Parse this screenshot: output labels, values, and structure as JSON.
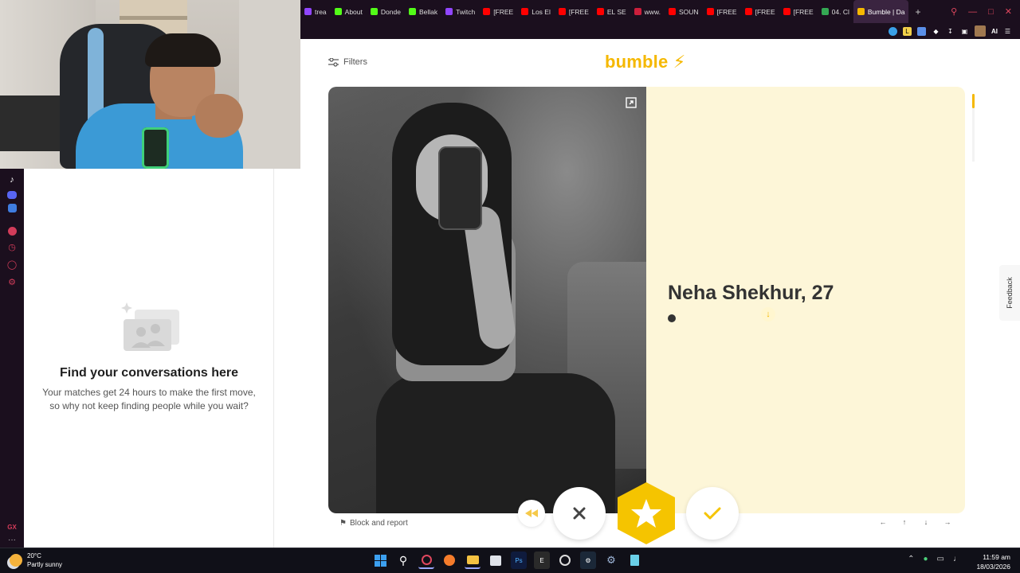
{
  "browser": {
    "tabs": [
      {
        "label": "trea",
        "color": "#9146ff"
      },
      {
        "label": "About",
        "color": "#53fc18"
      },
      {
        "label": "Donde",
        "color": "#53fc18"
      },
      {
        "label": "Bellak",
        "color": "#53fc18"
      },
      {
        "label": "Twitch",
        "color": "#9146ff"
      },
      {
        "label": "[FREE",
        "color": "#ff0000"
      },
      {
        "label": "Los El",
        "color": "#ff0000"
      },
      {
        "label": "[FREE",
        "color": "#ff0000"
      },
      {
        "label": "EL SE",
        "color": "#ff0000"
      },
      {
        "label": "www.",
        "color": "#cc1f3c"
      },
      {
        "label": "SOUN",
        "color": "#ff0000"
      },
      {
        "label": "[FREE",
        "color": "#ff0000"
      },
      {
        "label": "[FREE",
        "color": "#ff0000"
      },
      {
        "label": "[FREE",
        "color": "#ff0000"
      },
      {
        "label": "04. Cl",
        "color": "#34a853"
      },
      {
        "label": "Bumble | Da",
        "color": "#f5b800",
        "active": true
      }
    ],
    "new_tab": "+",
    "ai_label": "AI"
  },
  "sidebar_icons": [
    "tiktok-icon",
    "discord-icon",
    "messenger-icon",
    "spotify-icon",
    "history-icon",
    "chat-icon",
    "settings-icon"
  ],
  "sidebar_bottom": {
    "gx": "GX",
    "more": "···"
  },
  "conversations": {
    "title": "Find your conversations here",
    "subtitle": "Your matches get 24 hours to make the first move, so why not keep finding people while you wait?"
  },
  "header": {
    "filters_label": "Filters",
    "logo_text": "bumble"
  },
  "profile": {
    "name_age": "Neha Shekhur, 27"
  },
  "actions": {
    "block_report": "Block and report"
  },
  "keyboard_hints": [
    "←",
    "↑",
    "↓",
    "→"
  ],
  "feedback_label": "Feedback",
  "taskbar": {
    "temperature": "20°C",
    "condition": "Partly sunny",
    "time": "11:59 am",
    "date": "18/03/2026",
    "apps": [
      "windows-start",
      "search",
      "opera-gx",
      "browser",
      "file-explorer",
      "store",
      "photoshop",
      "epic-games",
      "ea-app",
      "steam",
      "settings",
      "notepad"
    ]
  },
  "colors": {
    "brand": "#f5b800",
    "info_panel": "#fdf6d8",
    "chrome_dark": "#1b0f1e"
  }
}
